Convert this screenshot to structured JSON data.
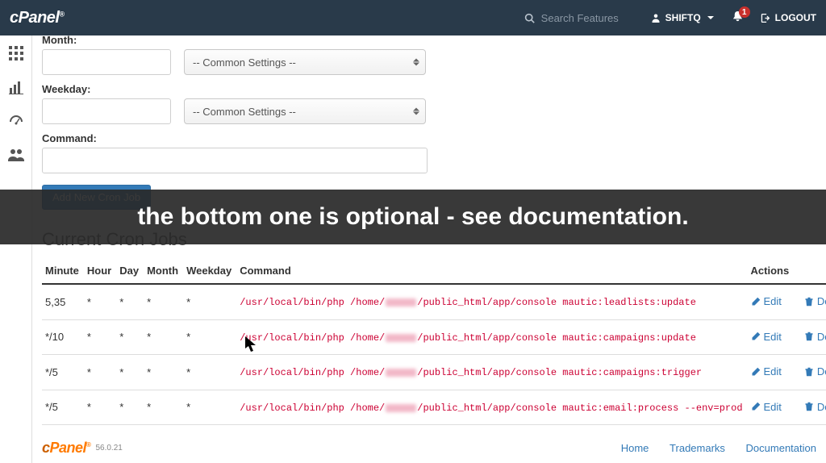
{
  "topbar": {
    "search_placeholder": "Search Features",
    "username": "SHIFTQ",
    "notif_count": "1",
    "logout_label": "LOGOUT"
  },
  "form": {
    "month_label": "Month:",
    "weekday_label": "Weekday:",
    "command_label": "Command:",
    "common_settings": "-- Common Settings --",
    "submit_label": "Add New Cron Job"
  },
  "overlay_text": "the bottom one is optional - see documentation.",
  "section_title": "Current Cron Jobs",
  "table": {
    "headers": {
      "minute": "Minute",
      "hour": "Hour",
      "day": "Day",
      "month": "Month",
      "weekday": "Weekday",
      "command": "Command",
      "actions": "Actions"
    },
    "actions": {
      "edit": "Edit",
      "delete": "Delete"
    },
    "rows": [
      {
        "minute": "5,35",
        "hour": "*",
        "day": "*",
        "month": "*",
        "weekday": "*",
        "cmd_pre": "/usr/local/bin/php /home/",
        "cmd_post": "/public_html/app/console mautic:leadlists:update"
      },
      {
        "minute": "*/10",
        "hour": "*",
        "day": "*",
        "month": "*",
        "weekday": "*",
        "cmd_pre": "/usr/local/bin/php /home/",
        "cmd_post": "/public_html/app/console mautic:campaigns:update"
      },
      {
        "minute": "*/5",
        "hour": "*",
        "day": "*",
        "month": "*",
        "weekday": "*",
        "cmd_pre": "/usr/local/bin/php /home/",
        "cmd_post": "/public_html/app/console mautic:campaigns:trigger"
      },
      {
        "minute": "*/5",
        "hour": "*",
        "day": "*",
        "month": "*",
        "weekday": "*",
        "cmd_pre": "/usr/local/bin/php /home/",
        "cmd_post": "/public_html/app/console mautic:email:process --env=prod"
      }
    ]
  },
  "footer": {
    "version": "56.0.21",
    "links": {
      "home": "Home",
      "trademarks": "Trademarks",
      "docs": "Documentation"
    }
  }
}
